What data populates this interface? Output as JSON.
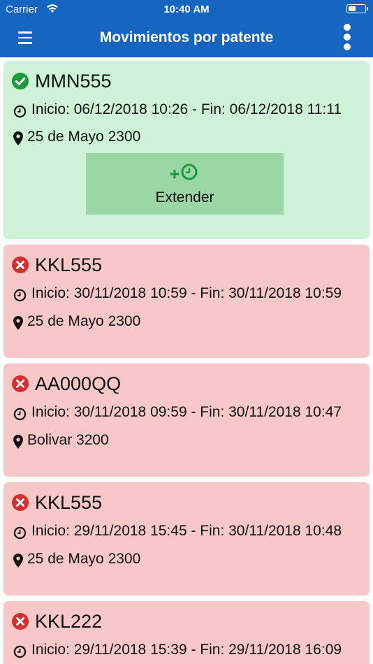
{
  "status_bar": {
    "carrier": "Carrier",
    "time": "10:40 AM",
    "battery_icon": "battery-icon",
    "wifi_icon": "wifi-icon"
  },
  "app_bar": {
    "title": "Movimientos por patente",
    "menu_icon": "hamburger-menu-icon",
    "more_icon": "more-vertical-icon",
    "color": "#1565c0"
  },
  "movements": [
    {
      "plate": "MMN555",
      "status": "active",
      "time": "Inicio: 06/12/2018 10:26 - Fin: 06/12/2018 11:11",
      "location": "25 de Mayo 2300",
      "action_label": "Extender"
    },
    {
      "plate": "KKL555",
      "status": "expired",
      "time": "Inicio: 30/11/2018 10:59 - Fin: 30/11/2018 10:59",
      "location": "25 de Mayo 2300"
    },
    {
      "plate": "AA000QQ",
      "status": "expired",
      "time": "Inicio: 30/11/2018 09:59 - Fin: 30/11/2018 10:47",
      "location": "Bolivar 3200"
    },
    {
      "plate": "KKL555",
      "status": "expired",
      "time": "Inicio: 29/11/2018 15:45 - Fin: 30/11/2018 10:48",
      "location": "25 de Mayo 2300"
    },
    {
      "plate": "KKL222",
      "status": "expired",
      "time": "Inicio: 29/11/2018 15:39 - Fin: 29/11/2018 16:09"
    }
  ],
  "colors": {
    "active_bg": "#cdf2d5",
    "expired_bg": "#f8c8c8",
    "active_icon": "#1a9a3a",
    "expired_icon": "#d32f2f",
    "extend_button": "#9bd7a5"
  }
}
